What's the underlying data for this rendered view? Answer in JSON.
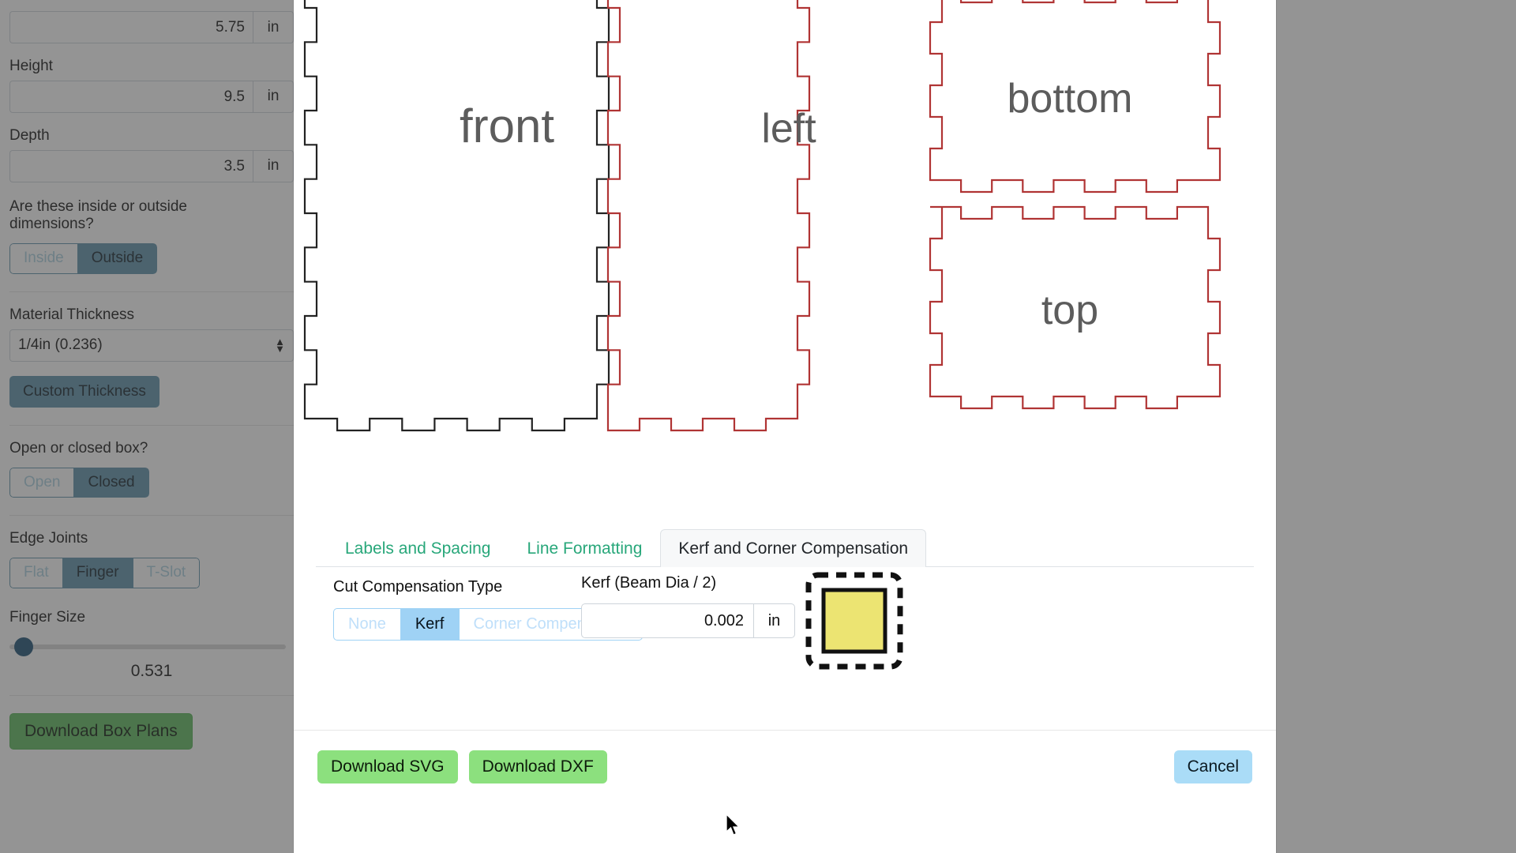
{
  "sidebar": {
    "width_value": "5.75",
    "width_unit": "in",
    "height_label": "Height",
    "height_value": "9.5",
    "height_unit": "in",
    "depth_label": "Depth",
    "depth_value": "3.5",
    "depth_unit": "in",
    "dimension_question": "Are these inside or outside dimensions?",
    "dimension_options": [
      "Inside",
      "Outside"
    ],
    "dimension_selected": "Outside",
    "material_thickness_label": "Material Thickness",
    "material_thickness_value": "1/4in (0.236)",
    "custom_thickness_label": "Custom Thickness",
    "open_closed_question": "Open or closed box?",
    "open_closed_options": [
      "Open",
      "Closed"
    ],
    "open_closed_selected": "Closed",
    "edge_joints_label": "Edge Joints",
    "edge_joints_options": [
      "Flat",
      "Finger",
      "T-Slot"
    ],
    "edge_joints_selected": "Finger",
    "finger_size_label": "Finger Size",
    "finger_size_value": "0.531",
    "download_box_plans_label": "Download Box Plans"
  },
  "modal": {
    "tabs": [
      {
        "label": "Labels and Spacing",
        "active": false
      },
      {
        "label": "Line Formatting",
        "active": false
      },
      {
        "label": "Kerf and Corner Compensation",
        "active": true
      }
    ],
    "kerf_panel": {
      "cut_compensation_label": "Cut Compensation Type",
      "cut_compensation_options": [
        "None",
        "Kerf",
        "Corner Compensation"
      ],
      "cut_compensation_selected": "Kerf",
      "kerf_label": "Kerf (Beam Dia / 2)",
      "kerf_value": "0.002",
      "kerf_unit": "in"
    },
    "footer": {
      "download_svg_label": "Download SVG",
      "download_dxf_label": "Download DXF",
      "cancel_label": "Cancel"
    },
    "preview": {
      "panel_labels": [
        "front",
        "left",
        "bottom",
        "top"
      ],
      "engrave_color": "#b03434",
      "cut_color": "#222222",
      "label_color": "#5c5c5c"
    }
  },
  "colors": {
    "accent_green": "#28a77a",
    "button_green": "#8ce07e",
    "button_blue": "#aadcf7",
    "segment_blue": "#9fd2f5",
    "sidebar_toggle_blue": "#5b8fa8",
    "kerf_fill": "#ece472",
    "backdrop": "#404040"
  }
}
